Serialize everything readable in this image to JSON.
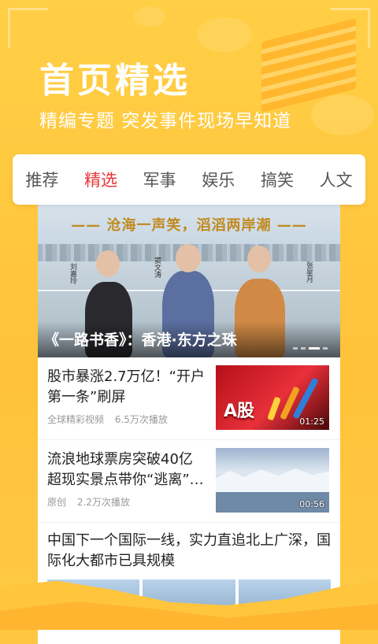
{
  "header": {
    "title": "首页精选",
    "subtitle": "精编专题  突发事件现场早知道"
  },
  "tabs": [
    {
      "label": "推荐",
      "active": false
    },
    {
      "label": "精选",
      "active": true
    },
    {
      "label": "军事",
      "active": false
    },
    {
      "label": "娱乐",
      "active": false
    },
    {
      "label": "搞笑",
      "active": false
    },
    {
      "label": "人文",
      "active": false
    }
  ],
  "hero": {
    "banner": "—— 沧海一声笑，滔滔两岸潮 ——",
    "caption": "《一路书香》：香港·东方之珠",
    "nameplates": [
      "刘嘉玲",
      "窦文涛",
      "张星月"
    ],
    "carousel_pages": 4,
    "carousel_active": 2
  },
  "news": [
    {
      "headline": "股市暴涨2.7万亿！“开户第一条”刷屏",
      "source": "全球精彩视频",
      "plays": "6.5万次播放",
      "duration": "01:25",
      "thumb_text": "A股"
    },
    {
      "headline": "流浪地球票房突破40亿 超现实景点带你“逃离”…",
      "source": "原创",
      "plays": "2.2万次播放",
      "duration": "00:56"
    }
  ],
  "news3": {
    "headline": "中国下一个国际一线，实力直追北上广深，国际化大都市已具规模"
  },
  "colors": {
    "background": "#ffc640",
    "accent": "#e8343a",
    "text": "#222222",
    "meta": "#999999"
  }
}
